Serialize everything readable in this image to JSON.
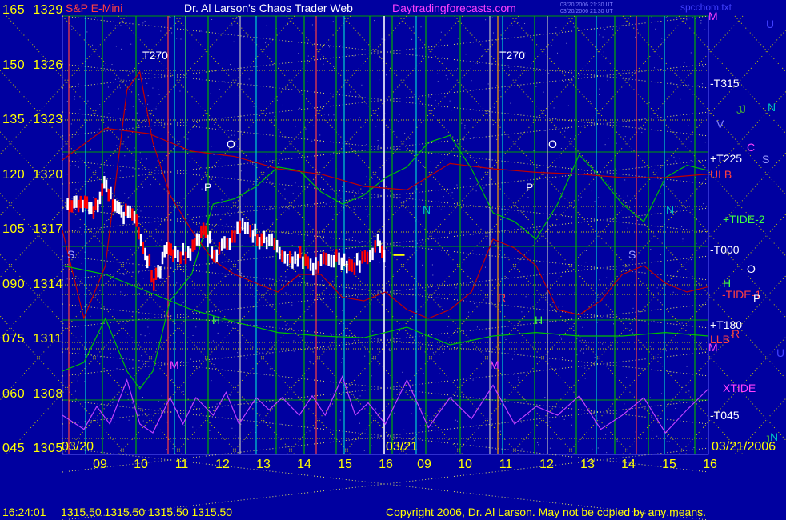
{
  "header": {
    "symbol": "S&P E-Mini",
    "title": "Dr. Al Larson's Chaos Trader Web",
    "site": "Daytradingforecasts.com",
    "tiny_lines": [
      "03/20/2006 21:30 UT",
      "03/20/2006 21:30 UT"
    ],
    "file": "spcchom.txt"
  },
  "y_axis": {
    "ticks": [
      {
        "index": "165",
        "price": "1329"
      },
      {
        "index": "150",
        "price": "1326"
      },
      {
        "index": "135",
        "price": "1323"
      },
      {
        "index": "120",
        "price": "1320"
      },
      {
        "index": "105",
        "price": "1317"
      },
      {
        "index": "090",
        "price": "1314"
      },
      {
        "index": "075",
        "price": "1311"
      },
      {
        "index": "060",
        "price": "1308"
      },
      {
        "index": "045",
        "price": "1305"
      }
    ]
  },
  "x_axis": {
    "ticks": [
      "09",
      "10",
      "11",
      "12",
      "13",
      "14",
      "15",
      "16",
      "09",
      "10",
      "11",
      "12",
      "13",
      "14",
      "15",
      "16"
    ],
    "date_left": "03/20",
    "date_mid": "03/21",
    "date_right": "03/21/2006"
  },
  "right_labels": [
    {
      "text": "M",
      "color": "#ff40ff"
    },
    {
      "text": "U",
      "color": "#4040ff"
    },
    {
      "text": "-T315",
      "color": "#ffffff"
    },
    {
      "text": "J",
      "color": "#40a040"
    },
    {
      "text": "N",
      "color": "#00c0c0"
    },
    {
      "text": "V",
      "color": "#8080ff"
    },
    {
      "text": "C",
      "color": "#ff40ff"
    },
    {
      "text": "+T225",
      "color": "#ffffff"
    },
    {
      "text": "S",
      "color": "#a0a0ff"
    },
    {
      "text": "ULB",
      "color": "#ff4040"
    },
    {
      "text": "+TIDE-2",
      "color": "#40ff40"
    },
    {
      "text": "-T000",
      "color": "#ffffff"
    },
    {
      "text": "O",
      "color": "#ffffff"
    },
    {
      "text": "H",
      "color": "#40ff40"
    },
    {
      "text": "-TIDE-1",
      "color": "#ff4040"
    },
    {
      "text": "P",
      "color": "#ffffff"
    },
    {
      "text": "+T180",
      "color": "#ffffff"
    },
    {
      "text": "LLB",
      "color": "#ff4040"
    },
    {
      "text": "R",
      "color": "#ff4040"
    },
    {
      "text": "M",
      "color": "#ff40ff"
    },
    {
      "text": "U",
      "color": "#4040ff"
    },
    {
      "text": "XTIDE",
      "color": "#ff40ff"
    },
    {
      "text": "-T045",
      "color": "#ffffff"
    },
    {
      "text": "J",
      "color": "#40a040"
    },
    {
      "text": "N",
      "color": "#00c0c0"
    }
  ],
  "annotations": [
    {
      "text": "T270",
      "color": "#ffffff"
    },
    {
      "text": "T270",
      "color": "#ffffff"
    },
    {
      "text": "O",
      "color": "#ffffff"
    },
    {
      "text": "O",
      "color": "#ffffff"
    },
    {
      "text": "P",
      "color": "#ffffff"
    },
    {
      "text": "P",
      "color": "#ffffff"
    },
    {
      "text": "N",
      "color": "#00c0c0"
    },
    {
      "text": "N",
      "color": "#00c0c0"
    },
    {
      "text": "S",
      "color": "#a0a0ff"
    },
    {
      "text": "S",
      "color": "#a0a0ff"
    },
    {
      "text": "H",
      "color": "#40ff40"
    },
    {
      "text": "H",
      "color": "#40ff40"
    },
    {
      "text": "M",
      "color": "#ff40ff"
    },
    {
      "text": "M",
      "color": "#ff40ff"
    },
    {
      "text": "R",
      "color": "#ff4040"
    },
    {
      "text": "J",
      "color": "#40a040"
    }
  ],
  "footer": {
    "time": "16:24:01",
    "quotes": "1315.50  1315.50  1315.50  1315.50",
    "copyright": "Copyright 2006, Dr. Al Larson. May not be copied by any means."
  },
  "colors": {
    "background": "#0000a0",
    "price_bars_up": "#ffffff",
    "price_bars_down": "#ff0000",
    "tide": "#00c000",
    "red_lines": "#c00000",
    "xtide": "#c040ff",
    "grid_dotted": "#c8c800",
    "vertical_markers": "#00d0d0",
    "axis_text": "#ffff00"
  },
  "chart_data": {
    "type": "line",
    "title": "S&P E-Mini",
    "ylim": [
      1305,
      1329
    ],
    "x_range": [
      "03/20 08:30",
      "03/21 16:00"
    ],
    "series": [
      {
        "name": "S&P E-Mini",
        "style": "bars",
        "points": [
          [
            8.6,
            1318.2
          ],
          [
            8.8,
            1318.5
          ],
          [
            9.0,
            1318.6
          ],
          [
            9.2,
            1318.0
          ],
          [
            9.4,
            1319.3
          ],
          [
            9.5,
            1319.6
          ],
          [
            9.7,
            1318.3
          ],
          [
            9.9,
            1317.8
          ],
          [
            10.0,
            1318.0
          ],
          [
            10.2,
            1317.6
          ],
          [
            10.3,
            1316.2
          ],
          [
            10.5,
            1315.2
          ],
          [
            10.6,
            1314.0
          ],
          [
            10.7,
            1314.5
          ],
          [
            10.9,
            1316.0
          ],
          [
            11.1,
            1315.8
          ],
          [
            11.4,
            1315.6
          ],
          [
            11.6,
            1316.3
          ],
          [
            11.8,
            1317.0
          ],
          [
            12.0,
            1315.7
          ],
          [
            12.3,
            1316.2
          ],
          [
            12.6,
            1317.3
          ],
          [
            12.9,
            1316.8
          ],
          [
            13.1,
            1316.5
          ],
          [
            13.4,
            1316.4
          ],
          [
            13.7,
            1315.2
          ],
          [
            14.0,
            1315.6
          ],
          [
            14.3,
            1314.9
          ],
          [
            14.6,
            1315.2
          ],
          [
            14.9,
            1315.5
          ],
          [
            15.2,
            1314.9
          ],
          [
            15.5,
            1315.4
          ],
          [
            15.8,
            1316.2
          ],
          [
            16.0,
            1315.6
          ]
        ]
      },
      {
        "name": "+TIDE-2",
        "style": "line",
        "points": [
          [
            8.5,
            1309
          ],
          [
            9.0,
            1309.5
          ],
          [
            9.5,
            1312
          ],
          [
            10.0,
            1309
          ],
          [
            10.3,
            1308
          ],
          [
            10.6,
            1309
          ],
          [
            11.0,
            1313
          ],
          [
            11.5,
            1314.5
          ],
          [
            12.0,
            1318.5
          ],
          [
            12.5,
            1318.8
          ],
          [
            13.0,
            1319.5
          ],
          [
            13.5,
            1320.6
          ],
          [
            14.0,
            1320.4
          ],
          [
            14.5,
            1319.2
          ],
          [
            15.0,
            1318.5
          ],
          [
            15.5,
            1319
          ],
          [
            16.0,
            1320
          ],
          [
            16.5,
            1320.6
          ],
          [
            17.0,
            1322
          ],
          [
            17.5,
            1322.4
          ],
          [
            18.0,
            1320.5
          ],
          [
            18.5,
            1318
          ],
          [
            19.0,
            1317.5
          ],
          [
            19.5,
            1316.5
          ],
          [
            20.0,
            1318.5
          ],
          [
            20.5,
            1321.3
          ],
          [
            21.0,
            1320
          ],
          [
            21.5,
            1318.5
          ],
          [
            22.0,
            1317.5
          ],
          [
            22.5,
            1320
          ],
          [
            23.0,
            1320.7
          ],
          [
            23.5,
            1320.4
          ]
        ]
      },
      {
        "name": "-TIDE-1",
        "style": "line",
        "points": [
          [
            8.5,
            1317
          ],
          [
            9.0,
            1312
          ],
          [
            9.5,
            1315
          ],
          [
            10.0,
            1325
          ],
          [
            10.3,
            1326
          ],
          [
            10.6,
            1322
          ],
          [
            11.0,
            1319
          ],
          [
            11.5,
            1317
          ],
          [
            12.0,
            1315.3
          ],
          [
            12.5,
            1314.5
          ],
          [
            13.0,
            1314
          ],
          [
            13.5,
            1313.5
          ],
          [
            14.0,
            1314.5
          ],
          [
            14.5,
            1314.5
          ],
          [
            15.0,
            1313.2
          ],
          [
            15.5,
            1313
          ],
          [
            16.0,
            1313.5
          ],
          [
            16.5,
            1312.5
          ],
          [
            17.0,
            1312
          ],
          [
            17.5,
            1312.5
          ],
          [
            18.0,
            1313.5
          ],
          [
            18.5,
            1316.5
          ],
          [
            19.0,
            1316
          ],
          [
            19.5,
            1315
          ],
          [
            20.0,
            1312.5
          ],
          [
            20.5,
            1312.2
          ],
          [
            21.0,
            1313
          ],
          [
            21.5,
            1314.5
          ],
          [
            22.0,
            1315
          ],
          [
            22.5,
            1314
          ],
          [
            23.0,
            1313.5
          ],
          [
            23.5,
            1313.8
          ]
        ]
      },
      {
        "name": "XTIDE",
        "style": "line",
        "points": [
          [
            8.5,
            1306.5
          ],
          [
            9.0,
            1305.7
          ],
          [
            9.3,
            1307
          ],
          [
            9.6,
            1306
          ],
          [
            10.0,
            1308.5
          ],
          [
            10.3,
            1306
          ],
          [
            10.6,
            1305.5
          ],
          [
            11.0,
            1307.5
          ],
          [
            11.3,
            1306
          ],
          [
            11.6,
            1307.5
          ],
          [
            12.0,
            1306.5
          ],
          [
            12.3,
            1307.8
          ],
          [
            12.6,
            1306
          ],
          [
            13.0,
            1307.5
          ],
          [
            13.3,
            1306.8
          ],
          [
            13.6,
            1307.5
          ],
          [
            14.0,
            1306.5
          ],
          [
            14.3,
            1307.6
          ],
          [
            14.6,
            1306.5
          ],
          [
            15.0,
            1308.7
          ],
          [
            15.3,
            1306.5
          ],
          [
            15.6,
            1307.2
          ],
          [
            16.0,
            1306
          ],
          [
            16.5,
            1308.5
          ],
          [
            17.0,
            1305.8
          ],
          [
            17.5,
            1307.5
          ],
          [
            18.0,
            1306.3
          ],
          [
            18.5,
            1308.2
          ],
          [
            19.0,
            1306
          ],
          [
            19.5,
            1307
          ],
          [
            20.0,
            1306.5
          ],
          [
            20.5,
            1307.6
          ],
          [
            21.0,
            1305.7
          ],
          [
            21.5,
            1306.5
          ],
          [
            22.0,
            1307.5
          ],
          [
            22.5,
            1305.5
          ],
          [
            23.0,
            1306.8
          ],
          [
            23.5,
            1308
          ]
        ]
      },
      {
        "name": "ULB",
        "style": "line",
        "points": [
          [
            8.5,
            1321
          ],
          [
            9.5,
            1322.8
          ],
          [
            10.5,
            1322.5
          ],
          [
            11.5,
            1321.5
          ],
          [
            12.5,
            1321.2
          ],
          [
            13.5,
            1320.5
          ],
          [
            14.5,
            1320.2
          ],
          [
            15.5,
            1319.5
          ],
          [
            16.5,
            1319.3
          ],
          [
            17.5,
            1320.8
          ],
          [
            18.5,
            1320.5
          ],
          [
            19.5,
            1320.3
          ],
          [
            20.5,
            1320.2
          ],
          [
            21.5,
            1320
          ],
          [
            22.5,
            1320
          ],
          [
            23.5,
            1320.2
          ]
        ]
      },
      {
        "name": "LLB",
        "style": "line",
        "points": [
          [
            8.5,
            1315
          ],
          [
            9.5,
            1314.5
          ],
          [
            10.5,
            1313.5
          ],
          [
            11.5,
            1312.5
          ],
          [
            12.5,
            1311.8
          ],
          [
            13.5,
            1311.2
          ],
          [
            14.5,
            1311
          ],
          [
            15.5,
            1310.9
          ],
          [
            16.5,
            1311.5
          ],
          [
            17.5,
            1310.5
          ],
          [
            18.5,
            1311
          ],
          [
            19.5,
            1311.2
          ],
          [
            20.5,
            1311
          ],
          [
            21.5,
            1311
          ],
          [
            22.5,
            1311.2
          ],
          [
            23.5,
            1311
          ]
        ]
      }
    ]
  }
}
